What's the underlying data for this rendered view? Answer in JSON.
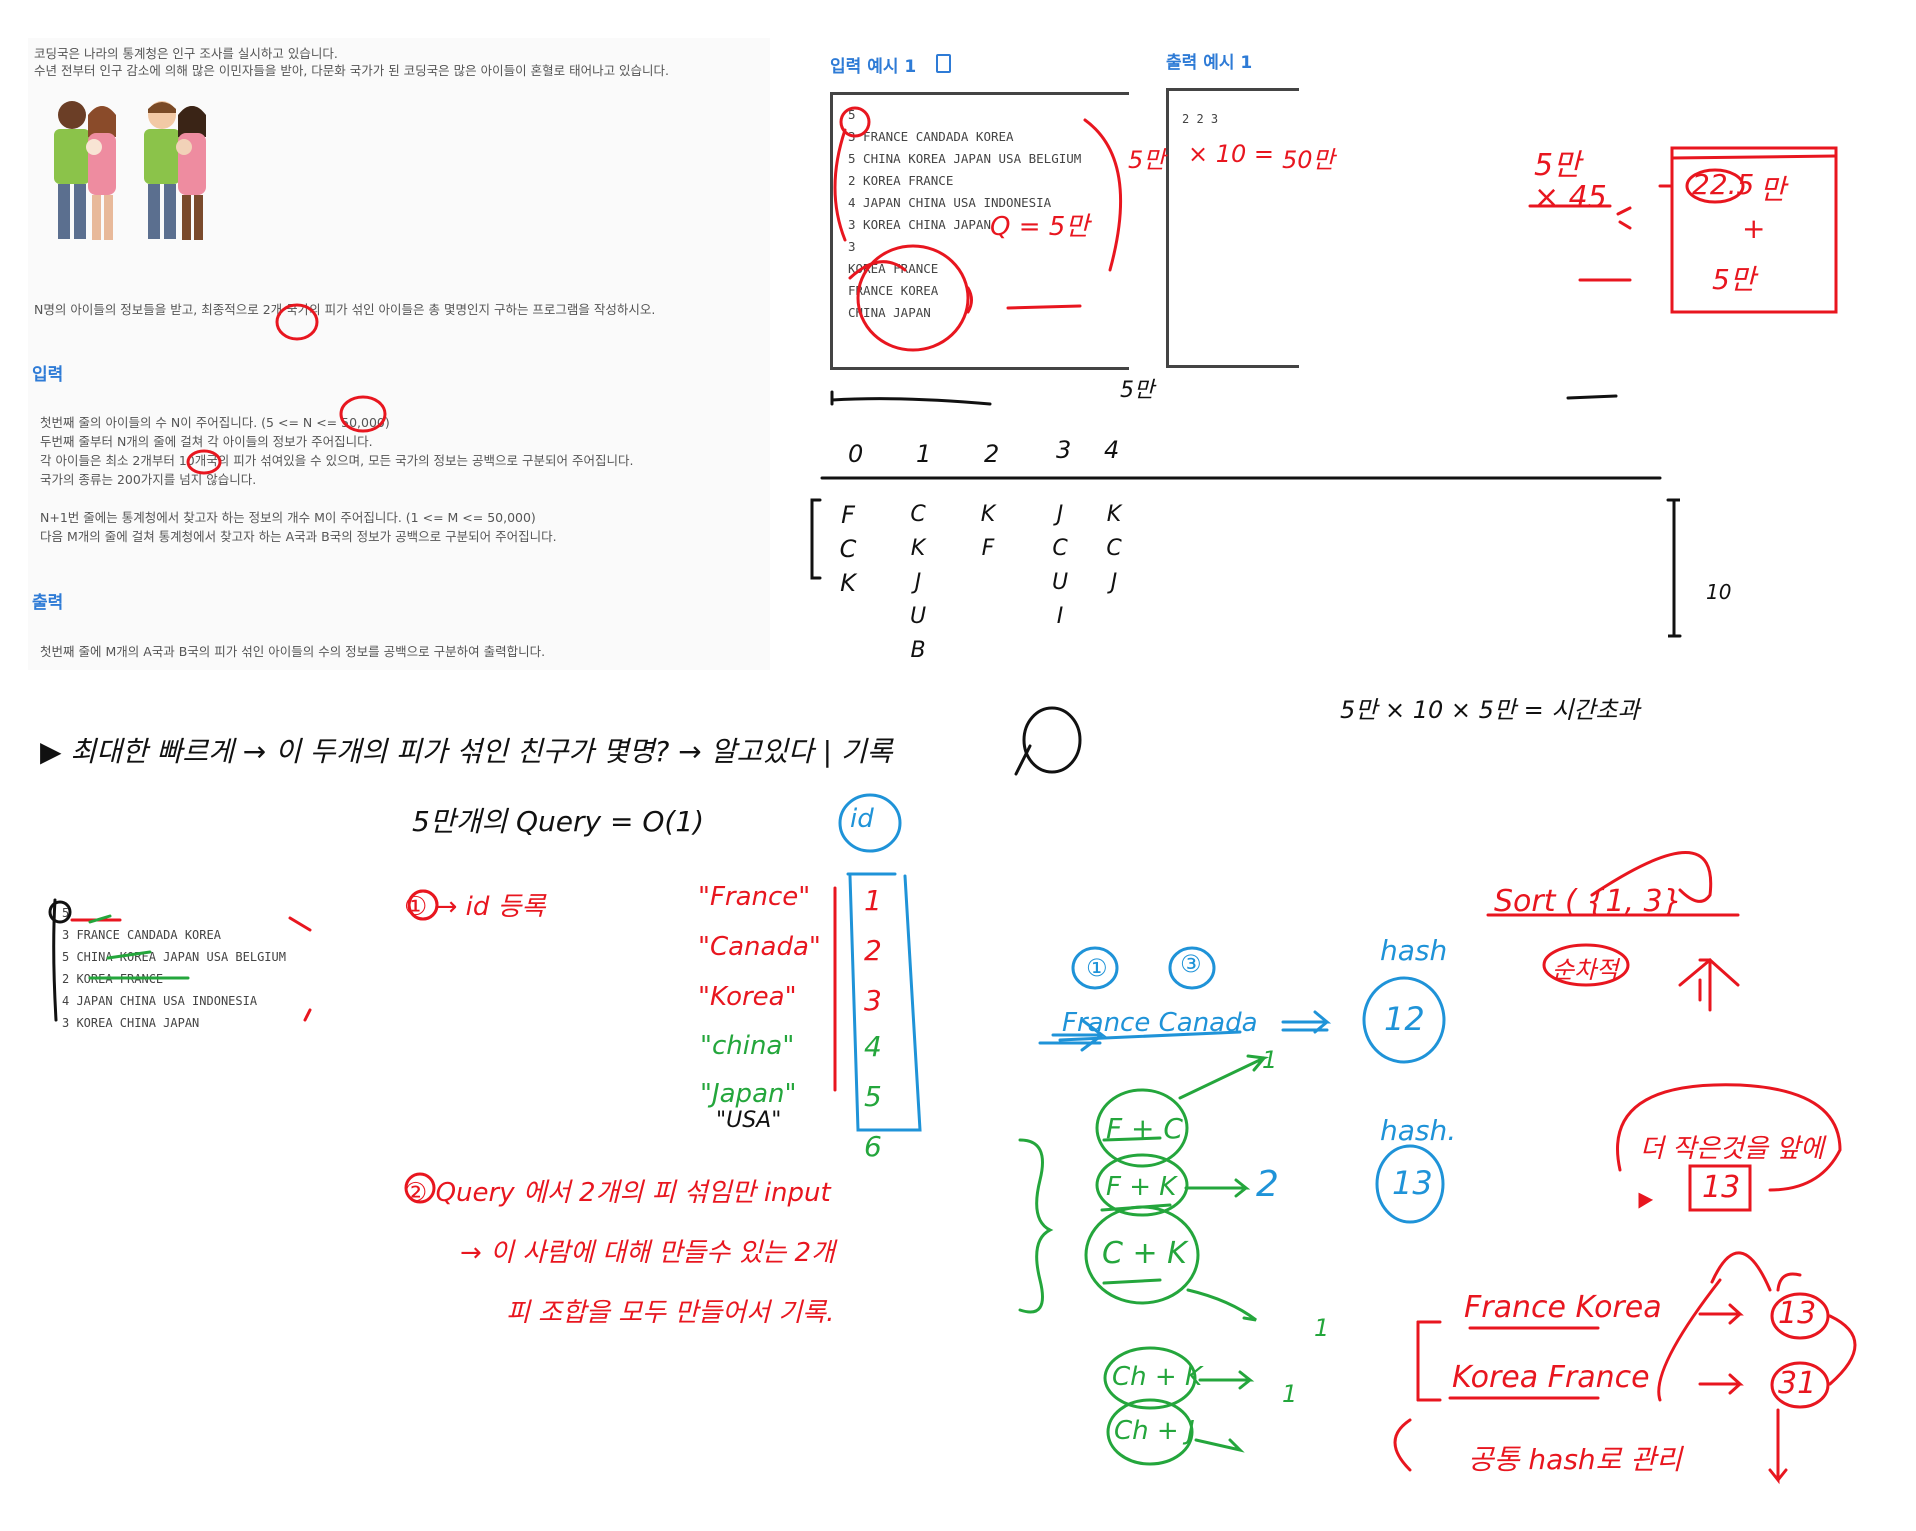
{
  "problem": {
    "intro1": "코딩국은 나라의 통계청은 인구 조사를 실시하고 있습니다.",
    "intro2": "수년 전부터 인구 감소에 의해 많은 이민자들을 받아, 다문화 국가가 된 코딩국은 많은 아이들이 혼혈로 태어나고 있습니다.",
    "task": "N명의 아이들의 정보들을 받고, 최종적으로 2개 국가의 피가 섞인 아이들은 총 몇명인지 구하는 프로그램을 작성하시오.",
    "input_heading": "입력",
    "input_lines": [
      "첫번째 줄의 아이들의 수 N이 주어집니다. (5 <= N <= 50,000)",
      "두번째 줄부터 N개의 줄에 걸쳐 각 아이들의 정보가 주어집니다.",
      "각 아이들은 최소 2개부터 10개국의 피가 섞여있을 수 있으며, 모든 국가의 정보는 공백으로 구분되어 주어집니다.",
      "국가의 종류는 200가지를 넘지 않습니다."
    ],
    "input_lines2": [
      "N+1번 줄에는 통계청에서 찾고자 하는 정보의 개수 M이 주어집니다. (1 <= M <= 50,000)",
      "다음 M개의 줄에 걸쳐 통계청에서 찾고자 하는 A국과 B국의 정보가 공백으로 구분되어 주어집니다."
    ],
    "output_heading": "출력",
    "output_line": "첫번째 줄에 M개의 A국과 B국의 피가 섞인 아이들의 수의 정보를 공백으로 구분하여 출력합니다."
  },
  "example": {
    "input_title": "입력 예시 1",
    "output_title": "출력 예시 1",
    "input_lines": [
      "5",
      "3 FRANCE CANDADA KOREA",
      "5 CHINA KOREA JAPAN USA BELGIUM",
      "2 KOREA FRANCE",
      "4 JAPAN CHINA USA INDONESIA",
      "3 KOREA CHINA JAPAN",
      "3",
      "KOREA FRANCE",
      "FRANCE KOREA",
      "CHINA JAPAN"
    ],
    "output_value": "2 2 3"
  },
  "snippet": {
    "lines": [
      "5",
      "3 FRANCE CANDADA KOREA",
      "5 CHINA KOREA JAPAN USA BELGIUM",
      "2 KOREA FRANCE",
      "4 JAPAN CHINA USA INDONESIA",
      "3 KOREA CHINA JAPAN"
    ]
  },
  "notes": {
    "q_equals": "Q = 5만",
    "mult1_a": "5만",
    "mult1_b": "× 10 =",
    "mult1_c": "50만",
    "five_man_a": "5만",
    "x45": "× 45",
    "box_225": "22.5",
    "box_man": "만",
    "box_plus": "+",
    "box_5man": "5만",
    "five_man_under": "5만",
    "idx": [
      "0",
      "1",
      "2",
      "3",
      "4"
    ],
    "col0": [
      "F",
      "C",
      "K"
    ],
    "col1": [
      "C",
      "K",
      "J",
      "U",
      "B"
    ],
    "col2": [
      "K",
      "F"
    ],
    "col3": [
      "J",
      "C",
      "U",
      "I"
    ],
    "col4": [
      "K",
      "C",
      "J"
    ],
    "ten": "10",
    "timeout": "5만 × 10 × 5만 = 시간초과",
    "headline": "▶ 최대한 빠르게 → 이 두개의 피가 섞인 친구가 몇명? → 알고있다 | 기록",
    "query_line": "5만개의 Query = O(1)",
    "step1": "① → id 등록",
    "countries": [
      "\"France\"",
      "\"Canada\"",
      "\"Korea\"",
      "\"china\"",
      "\"Japan\"",
      "\"USA\""
    ],
    "id_label": "id",
    "ids": [
      "1",
      "2",
      "3",
      "4",
      "5",
      "6"
    ],
    "step2": "② Query 에서 2개의 피 섞임만 input",
    "step2b": "→ 이 사람에 대해 만들수 있는 2개",
    "step2c": "피 조합을 모두 만들어서 기록.",
    "circ1": "①",
    "circ3": "③",
    "france_canada": "France Canada",
    "hash1": "hash",
    "hash1_val": "12",
    "hash2": "hash.",
    "hash2_val": "13",
    "fc": "F + C",
    "fk": "F + K",
    "ck": "C + K",
    "chk": "Ch + K",
    "chj": "Ch + J",
    "two": "2",
    "ones": [
      "1",
      "1",
      "1"
    ],
    "sort_line": "Sort ( {1, 3}",
    "sunseo": "순차적",
    "smaller": "더 작은것을 앞에",
    "thirteen": "13",
    "france_korea": "France Korea",
    "korea_france": "Korea France",
    "v13": "13",
    "v31": "31",
    "common": "공통 hash로 관리"
  }
}
